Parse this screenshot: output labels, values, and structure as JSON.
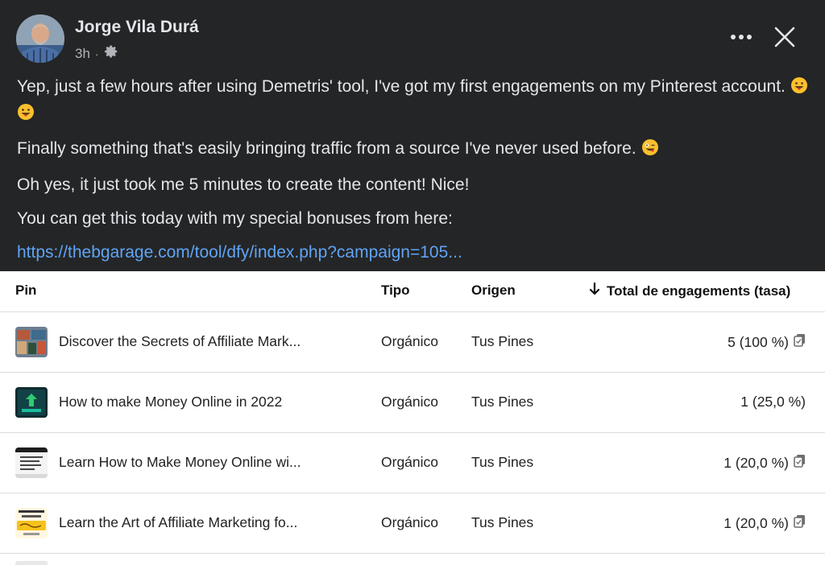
{
  "post": {
    "author": "Jorge Vila Durá",
    "time": "3h",
    "separator": "·",
    "paragraphs": [
      "Yep, just a few hours after using Demetris' tool, I've got my first engagements on my Pinterest account.",
      "Finally something that's easily bringing traffic from a source I've never used before.",
      "Oh yes, it just took me 5 minutes to create the content! Nice!",
      "You can get this today with my special bonuses from here:"
    ],
    "link": "https://thebgarage.com/tool/dfy/index.php?campaign=105..."
  },
  "table": {
    "headers": {
      "pin": "Pin",
      "tipo": "Tipo",
      "origen": "Origen",
      "total": "Total de engagements (tasa)"
    },
    "rows": [
      {
        "title": "Discover the Secrets of Affiliate Mark...",
        "tipo": "Orgánico",
        "origen": "Tus Pines",
        "total": "5 (100 %)"
      },
      {
        "title": "How to make Money Online in 2022",
        "tipo": "Orgánico",
        "origen": "Tus Pines",
        "total": "1 (25,0 %)"
      },
      {
        "title": "Learn How to Make Money Online wi...",
        "tipo": "Orgánico",
        "origen": "Tus Pines",
        "total": "1 (20,0 %)"
      },
      {
        "title": "Learn the Art of Affiliate Marketing fo...",
        "tipo": "Orgánico",
        "origen": "Tus Pines",
        "total": "1 (20,0 %)"
      }
    ]
  },
  "colors": {
    "post_bg": "#242526",
    "link": "#5fa4f5",
    "text": "#e4e6eb",
    "muted": "#b0b3b8"
  },
  "icons": [
    "gear-icon",
    "more-options-icon",
    "close-icon",
    "arrow-down-icon",
    "copy-icon",
    "emoji-icon"
  ]
}
